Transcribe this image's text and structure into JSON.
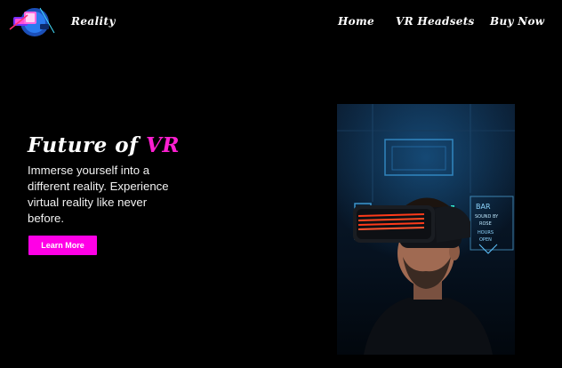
{
  "header": {
    "brand": "Reality",
    "nav": [
      {
        "label": "Home"
      },
      {
        "label": "VR Headsets"
      },
      {
        "label": "Buy Now"
      }
    ]
  },
  "hero": {
    "title_main": "Future of",
    "title_accent": "VR",
    "description": "Immerse yourself into a different reality. Experience virtual reality like never before.",
    "cta_label": "Learn More"
  },
  "photo": {
    "neon_sign_lines": [
      "BAR",
      "SOUND BY",
      "ROSE",
      "HOURS",
      "OPEN"
    ]
  },
  "colors": {
    "background": "#000000",
    "accent": "#ff1fd2",
    "button": "#ff00e6",
    "text": "#ffffff"
  }
}
